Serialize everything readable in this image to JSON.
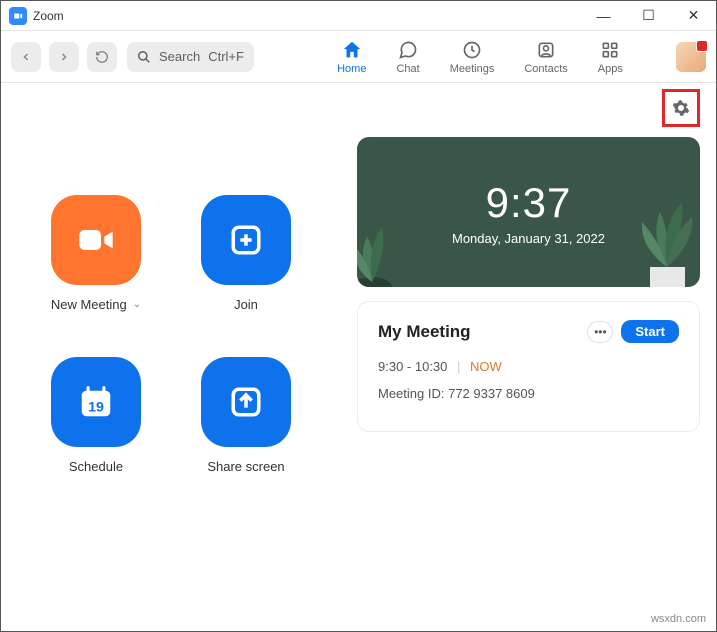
{
  "window": {
    "title": "Zoom"
  },
  "toolbar": {
    "search_label": "Search",
    "search_shortcut": "Ctrl+F",
    "tabs": {
      "home": "Home",
      "chat": "Chat",
      "meetings": "Meetings",
      "contacts": "Contacts",
      "apps": "Apps"
    }
  },
  "actions": {
    "new_meeting": "New Meeting",
    "join": "Join",
    "schedule": "Schedule",
    "schedule_day": "19",
    "share": "Share screen"
  },
  "clock": {
    "time": "9:37",
    "date": "Monday, January 31, 2022"
  },
  "meeting": {
    "title": "My Meeting",
    "start_label": "Start",
    "time_range": "9:30 - 10:30",
    "now_label": "NOW",
    "id_label": "Meeting ID: 772 9337 8609"
  },
  "watermark": "wsxdn.com"
}
